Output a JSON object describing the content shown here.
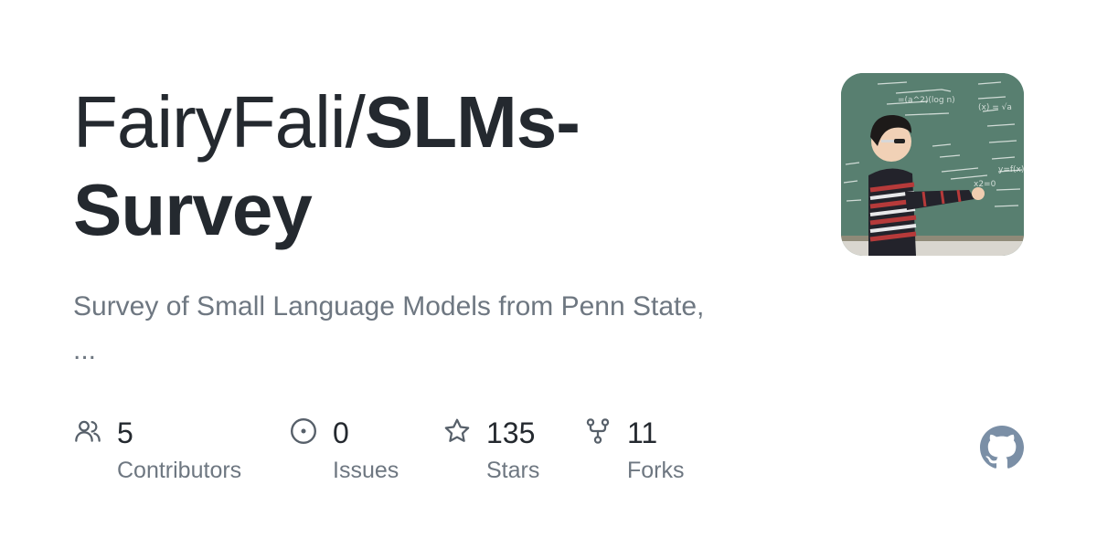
{
  "repo": {
    "owner_prefix": "FairyFali/",
    "name": "SLMs-Survey",
    "description": "Survey of Small Language Models from Penn State,",
    "description_more": "..."
  },
  "avatar": {
    "board_text": [
      "=(a^2)(log n)",
      "(x) = √a",
      "y=f(x)",
      "x2=0"
    ]
  },
  "stats": [
    {
      "icon": "people-icon",
      "value": "5",
      "label": "Contributors"
    },
    {
      "icon": "issue-opened-icon",
      "value": "0",
      "label": "Issues"
    },
    {
      "icon": "star-icon",
      "value": "135",
      "label": "Stars"
    },
    {
      "icon": "repo-forked-icon",
      "value": "11",
      "label": "Forks"
    }
  ],
  "brand": {
    "icon": "github-mark-icon",
    "color": "#7b8fa6"
  },
  "colors": {
    "text_primary": "#24292f",
    "text_secondary": "#6e7781",
    "icon": "#57606a"
  }
}
